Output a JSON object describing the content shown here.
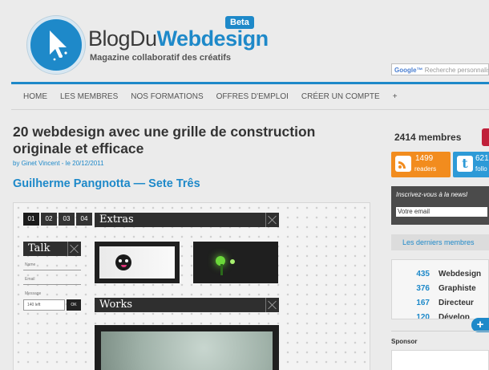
{
  "header": {
    "logo_light": "BlogDu",
    "logo_bold": "Webdesign",
    "beta": "Beta",
    "tagline": "Magazine collaboratif des créatifs",
    "search_brand": "Google™",
    "search_placeholder": "Recherche personnalisée"
  },
  "nav": {
    "items": [
      "HOME",
      "LES MEMBRES",
      "NOS FORMATIONS",
      "OFFRES D'EMPLOI",
      "CRÉER UN COMPTE",
      "+"
    ]
  },
  "article": {
    "title": "20 webdesign avec une grille de construction originale et efficace",
    "byline": "by Ginet Vincent - le 20/12/2011",
    "subtitle": "Guilherme Pangnotta — Sete Três",
    "showcase": {
      "pages": [
        "01",
        "02",
        "03",
        "04"
      ],
      "talk": "Talk",
      "extras": "Extras",
      "works": "Works",
      "form_labels": [
        "Name",
        "Email",
        "Message"
      ],
      "counter": "140 left",
      "ok": "OK"
    }
  },
  "sidebar": {
    "members_count": "2414 membres",
    "rss": {
      "count": "1499",
      "label": "readers"
    },
    "twitter": {
      "count": "621",
      "label": "follo"
    },
    "newsletter": {
      "title": "Inscrivez-vous à la newsl",
      "input_value": "Votre email"
    },
    "last_members": "Les derniers membres",
    "stats": [
      {
        "num": "435",
        "label": "Webdesign"
      },
      {
        "num": "376",
        "label": "Graphiste"
      },
      {
        "num": "167",
        "label": "Directeur"
      },
      {
        "num": "120",
        "label": "Dévelop"
      }
    ],
    "plus": "+",
    "sponsor": "Sponsor"
  },
  "colors": {
    "brand_blue": "#1e89c9",
    "rss_orange": "#f28c1e",
    "twitter_blue": "#2d9ad7",
    "accent_red": "#c0203a"
  }
}
